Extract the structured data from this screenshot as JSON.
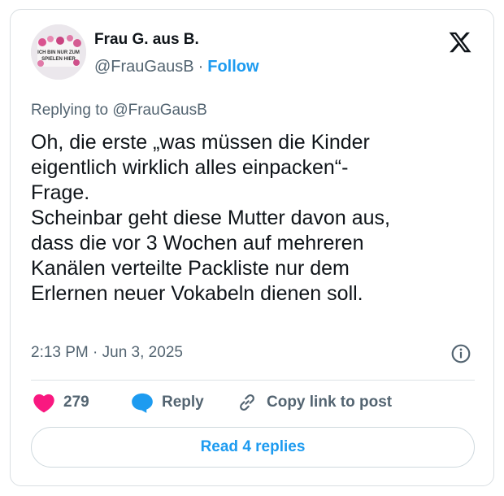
{
  "author": {
    "name": "Frau G. aus B.",
    "handle": "@FrauGausB",
    "separator": "·",
    "follow_label": "Follow",
    "avatar_text": [
      "ICH BIN NUR ZUM",
      "SPIELEN HIER"
    ]
  },
  "tweet": {
    "replying_to": "Replying to @FrauGausB",
    "text": "Oh, die erste „was müssen die Kinder\neigentlich wirklich alles einpacken“-\nFrage.\nScheinbar geht diese Mutter davon aus,\ndass die vor 3 Wochen auf mehreren\nKanälen verteilte Packliste nur dem\nErlernen neuer Vokabeln dienen soll.",
    "timestamp": "2:13 PM · Jun 3, 2025"
  },
  "actions": {
    "like_count": "279",
    "reply_label": "Reply",
    "copy_label": "Copy link to post",
    "read_replies_label": "Read 4 replies"
  },
  "colors": {
    "accent": "#1d9bf0",
    "like": "#f91880",
    "text": "#0f1419",
    "muted": "#536471",
    "border": "#d9dee2"
  },
  "icons": {
    "brand": "x-logo-icon",
    "info": "info-icon",
    "like": "heart-icon",
    "reply": "speech-bubble-icon",
    "copy": "link-icon"
  }
}
